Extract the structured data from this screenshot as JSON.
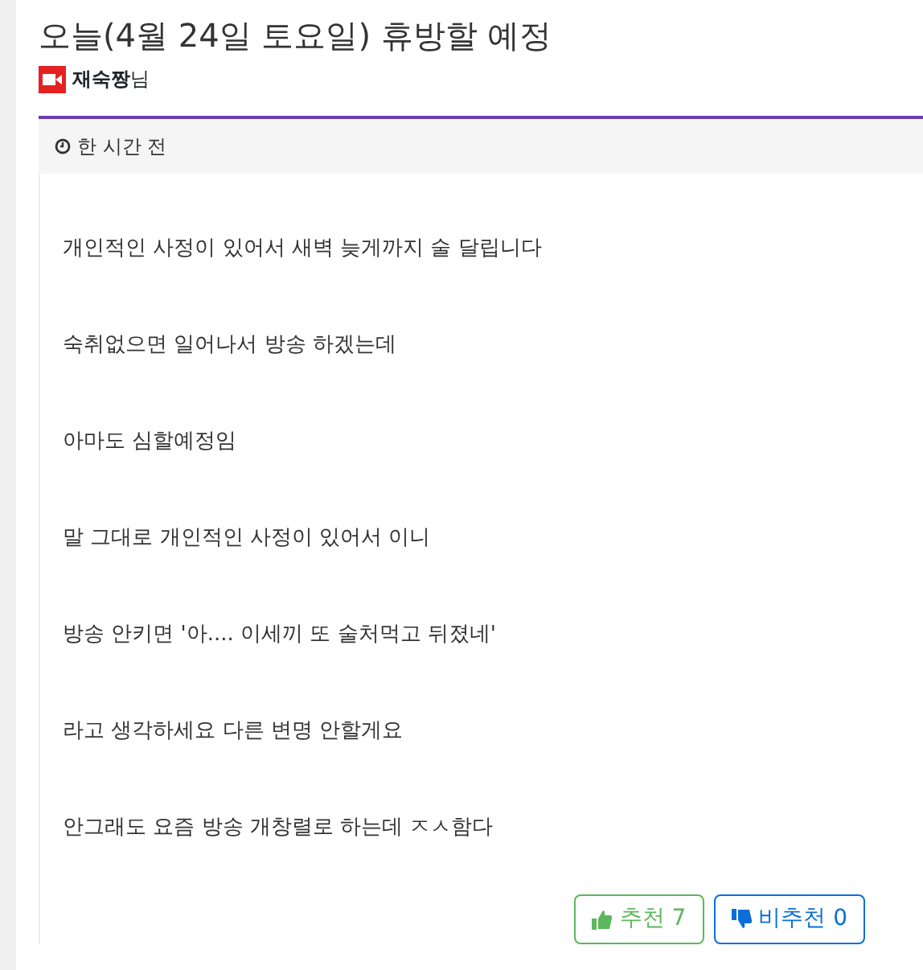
{
  "post": {
    "title": "오늘(4월 24일 토요일) 휴방할 예정",
    "author": "**재숙짱**님",
    "time": "한 시간 전",
    "paragraphs": [
      "개인적인 사정이 있어서 새벽 늦게까지 술 달립니다",
      "숙취없으면 일어나서 방송 하겠는데",
      "아마도 심할예정임",
      "말 그대로 개인적인 사정이 있어서 이니",
      "방송 안키면 '아.... 이세끼 또 술처먹고 뒤졌네'",
      "라고 생각하세요 다른 변명 안할게요",
      "안그래도 요즘 방송 개창렬로 하는데 ㅈㅅ함다"
    ],
    "votes": [
      {
        "kind": "up",
        "label": "추천 7"
      },
      {
        "kind": "down",
        "label": "비추천 0"
      }
    ]
  }
}
